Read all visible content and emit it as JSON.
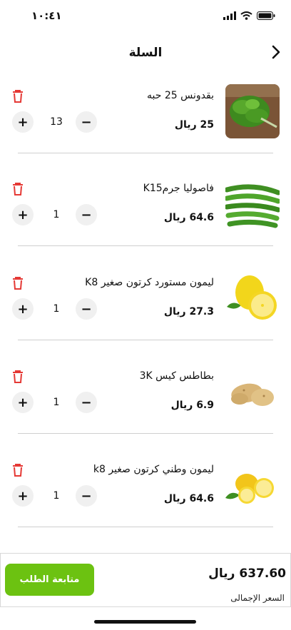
{
  "status_bar": {
    "time": "١٠:٤١"
  },
  "header": {
    "title": "السلة",
    "back_icon": "chevron-right-icon"
  },
  "items": [
    {
      "name": "بقدونس 25 حبه",
      "price": "25 ريال",
      "qty": "13"
    },
    {
      "name": "فاصوليا جرمK15",
      "price": "64.6 ريال",
      "qty": "1"
    },
    {
      "name": "ليمون مستورد كرتون صغير K8",
      "price": "27.3 ريال",
      "qty": "1"
    },
    {
      "name": "بطاطس كيس 3K",
      "price": "6.9 ريال",
      "qty": "1"
    },
    {
      "name": "ليمون وطني كرتون صغير k8",
      "price": "64.6 ريال",
      "qty": "1"
    }
  ],
  "footer": {
    "checkout_label": "متابعة الطلب",
    "total_value": "637.60 ريال",
    "total_label": "السعر الإجمالى"
  },
  "colors": {
    "accent": "#6cc211",
    "delete": "#e53935"
  }
}
